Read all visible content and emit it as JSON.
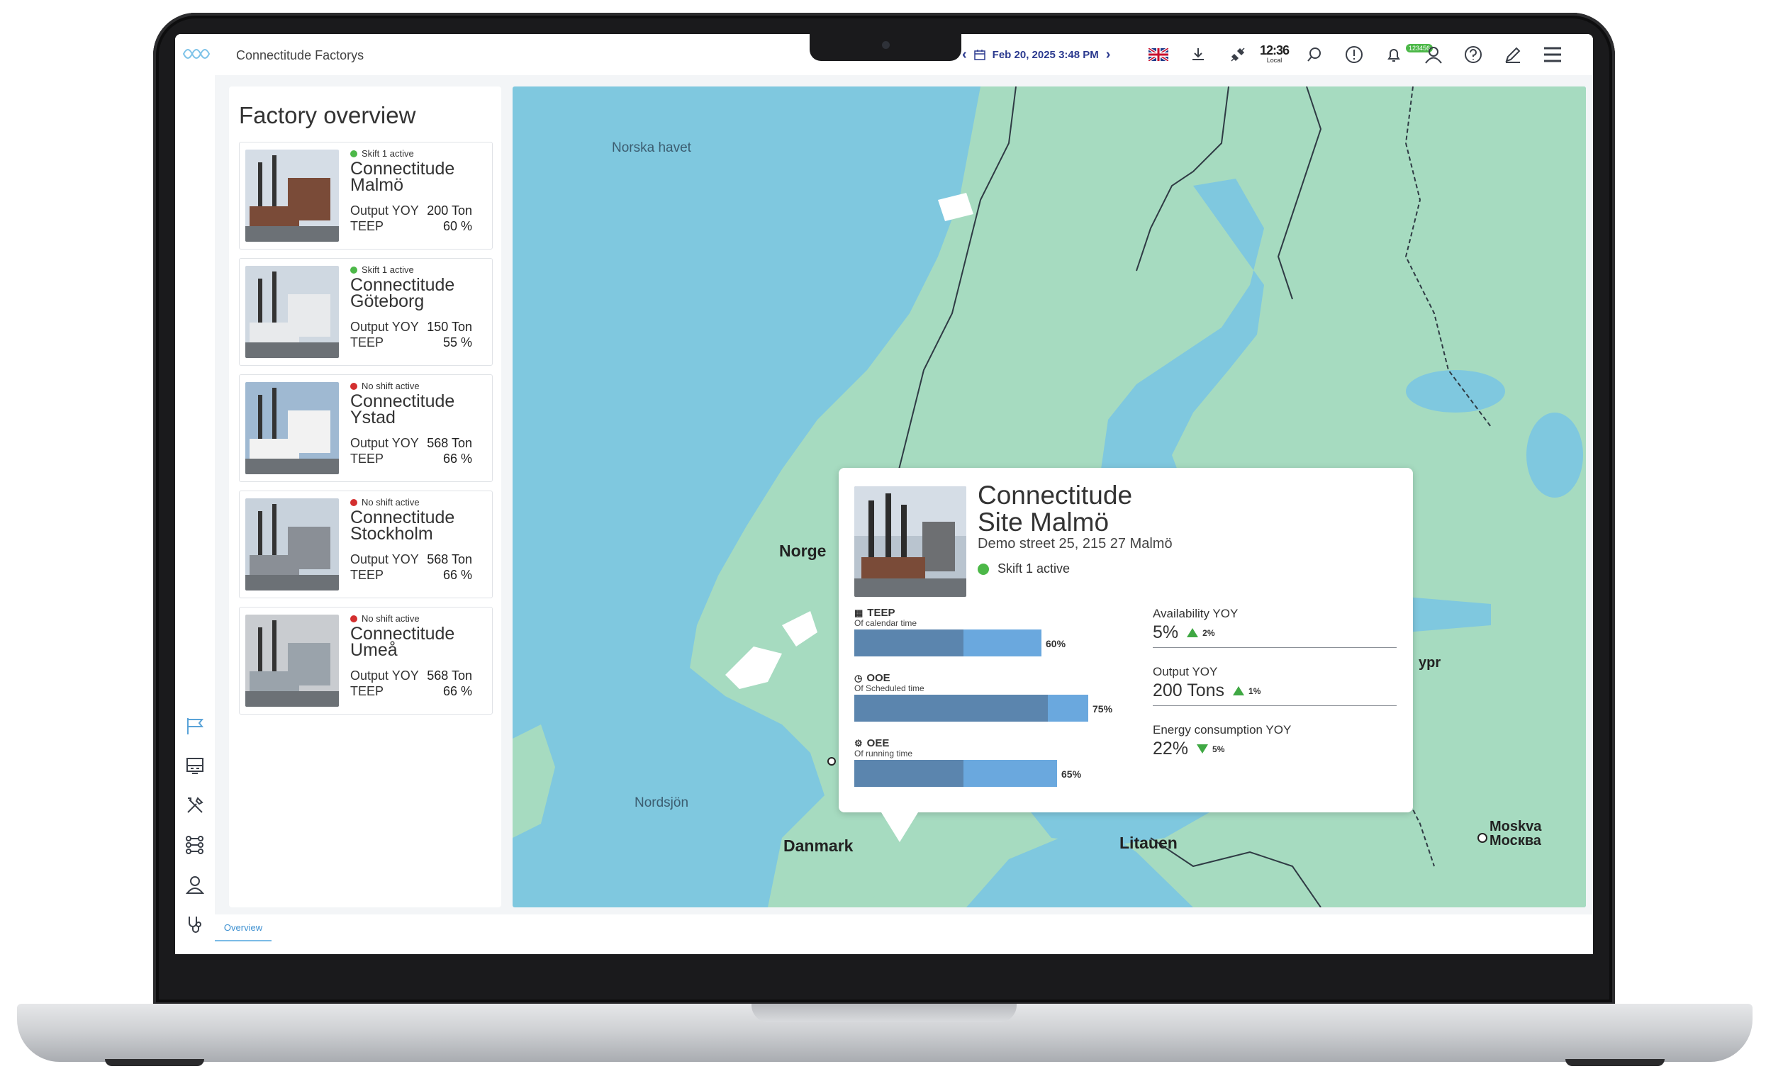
{
  "app": {
    "title": "Connectitude Factorys"
  },
  "topbar": {
    "date": "Feb 20, 2025 3:48 PM",
    "time": "12:36",
    "timezone": "Local",
    "notification_count": "123456"
  },
  "overview": {
    "title": "Factory overview",
    "output_label": "Output YOY",
    "teep_label": "TEEP",
    "factories": [
      {
        "shift": "Skift 1 active",
        "status_color": "#4cb848",
        "name": "Connectitude Malmö",
        "output": "200 Ton",
        "teep": "60 %"
      },
      {
        "shift": "Skift 1 active",
        "status_color": "#4cb848",
        "name": "Connectitude Göteborg",
        "output": "150 Ton",
        "teep": "55 %"
      },
      {
        "shift": "No shift active",
        "status_color": "#d32f2f",
        "name": "Connectitude Ystad",
        "output": "568 Ton",
        "teep": "66 %"
      },
      {
        "shift": "No shift active",
        "status_color": "#d32f2f",
        "name": "Connectitude Stockholm",
        "output": "568 Ton",
        "teep": "66 %"
      },
      {
        "shift": "No shift active",
        "status_color": "#d32f2f",
        "name": "Connectitude Umeå",
        "output": "568 Ton",
        "teep": "66 %"
      }
    ]
  },
  "map": {
    "labels": {
      "sea_north": "Norska havet",
      "sea_south": "Nordsjön",
      "norway": "Norge",
      "denmark": "Danmark",
      "lithuania": "Litauen",
      "moscow": "Moskva\nМосква",
      "partial": "ypr"
    }
  },
  "popup": {
    "title_line1": "Connectitude",
    "title_line2": "Site Malmö",
    "address": "Demo street 25, 215 27 Malmö",
    "shift": "Skift 1 active",
    "metrics": [
      {
        "label": "TEEP",
        "sub": "Of calendar time",
        "value": "60%",
        "fill": 0.6,
        "inner": 0.35
      },
      {
        "label": "OOE",
        "sub": "Of Scheduled time",
        "value": "75%",
        "fill": 0.75,
        "inner": 0.62
      },
      {
        "label": "OEE",
        "sub": "Of running time",
        "value": "65%",
        "fill": 0.65,
        "inner": 0.35
      }
    ],
    "yoy": [
      {
        "label": "Availability YOY",
        "value": "5%",
        "delta": "2%",
        "direction": "up"
      },
      {
        "label": "Output YOY",
        "value": "200 Tons",
        "delta": "1%",
        "direction": "up"
      },
      {
        "label": "Energy consumption YOY",
        "value": "22%",
        "delta": "5%",
        "direction": "down"
      }
    ]
  },
  "bottom": {
    "tab": "Overview"
  }
}
